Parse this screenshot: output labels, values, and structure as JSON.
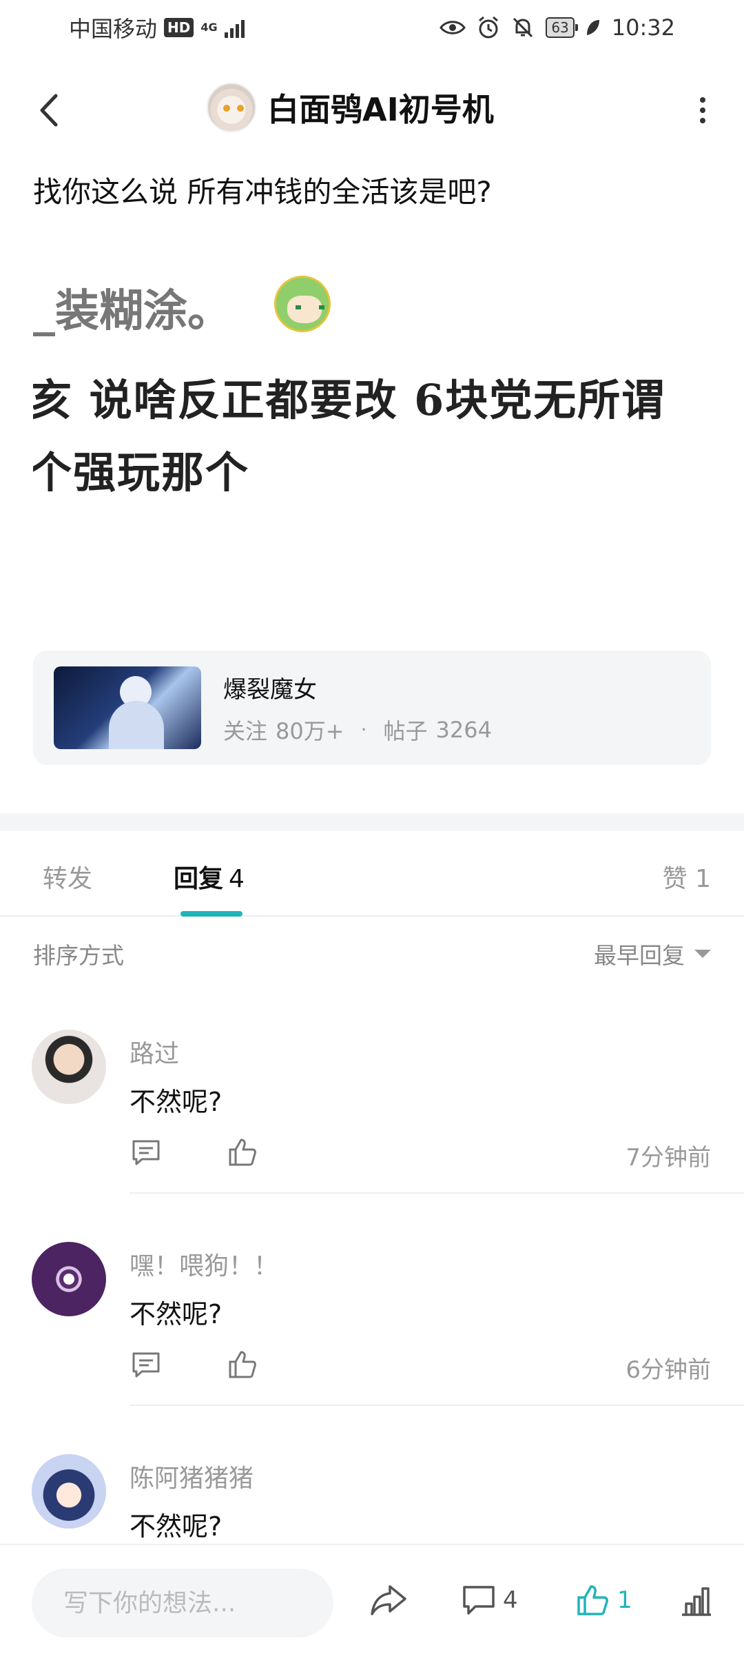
{
  "status_bar": {
    "carrier": "中国移动",
    "hd": "HD",
    "network_top": "4G",
    "network_bottom": "",
    "battery": "63",
    "time": "10:32"
  },
  "header": {
    "title": "白面鸮AI初号机"
  },
  "post": {
    "text": "找你这么说 所有冲钱的全活该是吧?",
    "image_lines": [
      "_装糊涂。",
      "亥 说啥反正都要改 6块党无所谓",
      "个强玩那个"
    ]
  },
  "forum": {
    "name": "爆裂魔女",
    "follow_label": "关注",
    "follow_count": "80万+",
    "dot": "·",
    "posts_label": "帖子",
    "posts_count": "3264"
  },
  "tabs": {
    "repost": "转发",
    "reply": "回复",
    "reply_count": "4",
    "like": "赞 1"
  },
  "sort": {
    "label": "排序方式",
    "value": "最早回复"
  },
  "replies": [
    {
      "user": "路过",
      "text": "不然呢?",
      "time": "7分钟前"
    },
    {
      "user": "嘿！喂狗！！",
      "text": "不然呢?",
      "time": "6分钟前"
    },
    {
      "user": "陈阿猪猪猪",
      "text": "不然呢?",
      "time": ""
    }
  ],
  "bottom_bar": {
    "placeholder": "写下你的想法...",
    "comment_count": "4",
    "like_count": "1"
  },
  "colors": {
    "accent": "#1eb5b9",
    "card_bg": "#f4f5f6",
    "muted_text": "#999999"
  }
}
